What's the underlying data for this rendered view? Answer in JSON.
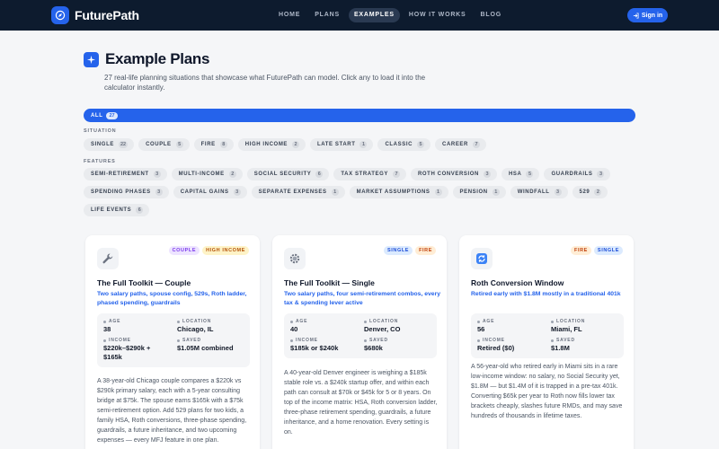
{
  "nav": {
    "brand": "FuturePath",
    "links": [
      "HOME",
      "PLANS",
      "EXAMPLES",
      "HOW IT WORKS",
      "BLOG"
    ],
    "sign_in": "Sign in"
  },
  "header": {
    "title": "Example Plans",
    "subtitle": "27 real-life planning situations that showcase what FuturePath can model. Click any to load it into the calculator instantly."
  },
  "filters": {
    "all": {
      "label": "ALL",
      "count": "27"
    },
    "situation_label": "SITUATION",
    "situation": [
      {
        "label": "SINGLE",
        "count": "22"
      },
      {
        "label": "COUPLE",
        "count": "5"
      },
      {
        "label": "FIRE",
        "count": "8"
      },
      {
        "label": "HIGH INCOME",
        "count": "2"
      },
      {
        "label": "LATE START",
        "count": "1"
      },
      {
        "label": "CLASSIC",
        "count": "5"
      },
      {
        "label": "CAREER",
        "count": "7"
      }
    ],
    "features_label": "FEATURES",
    "features_row1": [
      {
        "label": "SEMI-RETIREMENT",
        "count": "3"
      },
      {
        "label": "MULTI-INCOME",
        "count": "2"
      },
      {
        "label": "SOCIAL SECURITY",
        "count": "6"
      },
      {
        "label": "TAX STRATEGY",
        "count": "7"
      },
      {
        "label": "ROTH CONVERSION",
        "count": "3"
      },
      {
        "label": "HSA",
        "count": "5"
      },
      {
        "label": "GUARDRAILS",
        "count": "3"
      }
    ],
    "features_row2": [
      {
        "label": "SPENDING PHASES",
        "count": "3"
      },
      {
        "label": "CAPITAL GAINS",
        "count": "3"
      },
      {
        "label": "SEPARATE EXPENSES",
        "count": "1"
      },
      {
        "label": "MARKET ASSUMPTIONS",
        "count": "1"
      },
      {
        "label": "PENSION",
        "count": "1"
      },
      {
        "label": "WINDFALL",
        "count": "3"
      },
      {
        "label": "529",
        "count": "2"
      }
    ],
    "features_row3": [
      {
        "label": "LIFE EVENTS",
        "count": "6"
      }
    ]
  },
  "cards": [
    {
      "icon": "wrench-icon",
      "tags": [
        "COUPLE",
        "HIGH INCOME"
      ],
      "title": "The Full Toolkit — Couple",
      "tagline": "Two salary paths, spouse config, 529s, Roth ladder, phased spending, guardrails",
      "age_label": "AGE",
      "age": "38",
      "location_label": "LOCATION",
      "location": "Chicago, IL",
      "income_label": "INCOME",
      "income": "$220k–$290k + $165k",
      "saved_label": "SAVED",
      "saved": "$1.05M combined",
      "description": "A 38-year-old Chicago couple compares a $220k vs $290k primary salary, each with a 5-year consulting bridge at $75k. The spouse earns $165k with a $75k semi-retirement option. Add 529 plans for two kids, a family HSA, Roth conversions, three-phase spending, guardrails, a future inheritance, and two upcoming expenses — every MFJ feature in one plan."
    },
    {
      "icon": "gear-icon",
      "tags": [
        "SINGLE",
        "FIRE"
      ],
      "title": "The Full Toolkit — Single",
      "tagline": "Two salary paths, four semi-retirement combos, every tax & spending lever active",
      "age_label": "AGE",
      "age": "40",
      "location_label": "LOCATION",
      "location": "Denver, CO",
      "income_label": "INCOME",
      "income": "$185k or $240k",
      "saved_label": "SAVED",
      "saved": "$680k",
      "description": "A 40-year-old Denver engineer is weighing a $185k stable role vs. a $240k startup offer, and within each path can consult at $70k or $45k for 5 or 8 years. On top of the income matrix: HSA, Roth conversion ladder, three-phase retirement spending, guardrails, a future inheritance, and a home renovation. Every setting is on."
    },
    {
      "icon": "refresh-icon",
      "tags": [
        "FIRE",
        "SINGLE"
      ],
      "title": "Roth Conversion Window",
      "tagline": "Retired early with $1.8M mostly in a traditional 401k",
      "age_label": "AGE",
      "age": "56",
      "location_label": "LOCATION",
      "location": "Miami, FL",
      "income_label": "INCOME",
      "income": "Retired ($0)",
      "saved_label": "SAVED",
      "saved": "$1.8M",
      "description": "A 56-year-old who retired early in Miami sits in a rare low-income window: no salary, no Social Security yet, $1.8M — but $1.4M of it is trapped in a pre-tax 401k. Converting $65k per year to Roth now fills lower tax brackets cheaply, slashes future RMDs, and may save hundreds of thousands in lifetime taxes."
    }
  ]
}
